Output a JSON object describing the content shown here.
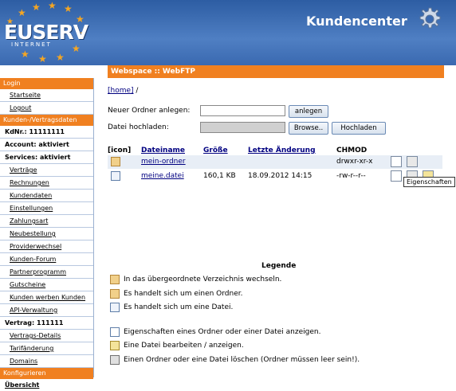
{
  "header": {
    "logo_text": "EUSERV",
    "logo_sub": "INTERNET",
    "title": "Kundencenter"
  },
  "sidebar": [
    {
      "type": "head",
      "label": "Login"
    },
    {
      "type": "link",
      "label": "Startseite"
    },
    {
      "type": "link",
      "label": "Logout"
    },
    {
      "type": "head",
      "label": "Kunden-/Vertragsdaten"
    },
    {
      "type": "static",
      "label": "KdNr.: 11111111"
    },
    {
      "type": "static",
      "label": "Account: aktiviert"
    },
    {
      "type": "static",
      "label": "Services: aktiviert"
    },
    {
      "type": "link",
      "label": "Verträge"
    },
    {
      "type": "link",
      "label": "Rechnungen"
    },
    {
      "type": "link",
      "label": "Kundendaten"
    },
    {
      "type": "link",
      "label": "Einstellungen"
    },
    {
      "type": "link",
      "label": "Zahlungsart"
    },
    {
      "type": "link",
      "label": "Neubestellung"
    },
    {
      "type": "link",
      "label": "Providerwechsel"
    },
    {
      "type": "link",
      "label": "Kunden-Forum"
    },
    {
      "type": "link",
      "label": "Partnerprogramm"
    },
    {
      "type": "link",
      "label": "Gutscheine"
    },
    {
      "type": "link",
      "label": "Kunden werben Kunden"
    },
    {
      "type": "link",
      "label": "API-Verwaltung"
    },
    {
      "type": "static",
      "label": "Vertrag: 111111"
    },
    {
      "type": "link",
      "label": "Vertrags-Details"
    },
    {
      "type": "link",
      "label": "Tarifänderung"
    },
    {
      "type": "link",
      "label": "Domains"
    },
    {
      "type": "head",
      "label": "Konfigurieren"
    },
    {
      "type": "selected",
      "label": "Übersicht"
    }
  ],
  "main": {
    "title": "Webspace :: WebFTP",
    "breadcrumb_home": "[home]",
    "breadcrumb_sep": "/",
    "new_folder_label": "Neuer Ordner anlegen:",
    "new_folder_button": "anlegen",
    "upload_label": "Datei hochladen:",
    "browse_button": "Browse..",
    "upload_button": "Hochladen",
    "columns": {
      "icon": "[icon]",
      "name": "Dateiname",
      "size": "Größe",
      "date": "Letzte Änderung",
      "chmod": "CHMOD"
    },
    "rows": [
      {
        "type": "folder",
        "name": "mein-ordner",
        "size": "",
        "date": "",
        "chmod": "drwxr-xr-x"
      },
      {
        "type": "file",
        "name": "meine.datei",
        "size": "160,1 KB",
        "date": "18.09.2012 14:15",
        "chmod": "-rw-r--r--"
      }
    ],
    "tooltip": "Eigenschaften",
    "legend_title": "Legende",
    "legend": [
      {
        "icon": "up-folder-icon",
        "text": "In das übergeordnete Verzeichnis wechseln."
      },
      {
        "icon": "folder-icon",
        "text": "Es handelt sich um einen Ordner."
      },
      {
        "icon": "file-icon",
        "text": "Es handelt sich um eine Datei."
      },
      {
        "icon": "properties-icon",
        "text": "Eigenschaften eines Ordner oder einer Datei anzeigen."
      },
      {
        "icon": "edit-icon",
        "text": "Eine Datei bearbeiten / anzeigen."
      },
      {
        "icon": "delete-icon",
        "text": "Einen Ordner oder eine Datei löschen (Ordner müssen leer sein!)."
      }
    ]
  },
  "colors": {
    "accent": "#f08020",
    "header_blue": "#3a69b0",
    "link": "#000080"
  }
}
